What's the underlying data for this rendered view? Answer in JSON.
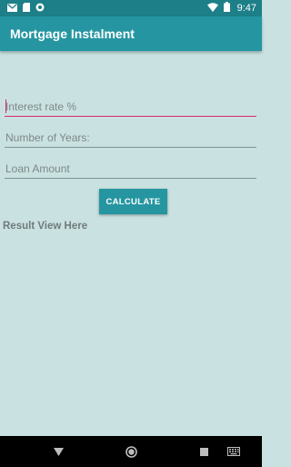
{
  "status_bar": {
    "time": "9:47",
    "icons": [
      "gmail-icon",
      "sd-card-icon",
      "sync-circle-icon",
      "wifi-icon",
      "battery-icon"
    ]
  },
  "app_bar": {
    "title": "Mortgage Instalment"
  },
  "form": {
    "interest_placeholder": "Interest rate %",
    "years_placeholder": "Number of Years:",
    "amount_placeholder": "Loan Amount",
    "calculate_label": "CALCULATE"
  },
  "result": {
    "text": "Result View Here"
  },
  "nav_bar": {
    "buttons": [
      "back-icon",
      "home-icon",
      "recents-icon",
      "keyboard-icon"
    ]
  },
  "colors": {
    "primary": "#2596a1",
    "primary_dark": "#1d7f87",
    "accent": "#d6296b",
    "background": "#c9e2e1"
  }
}
